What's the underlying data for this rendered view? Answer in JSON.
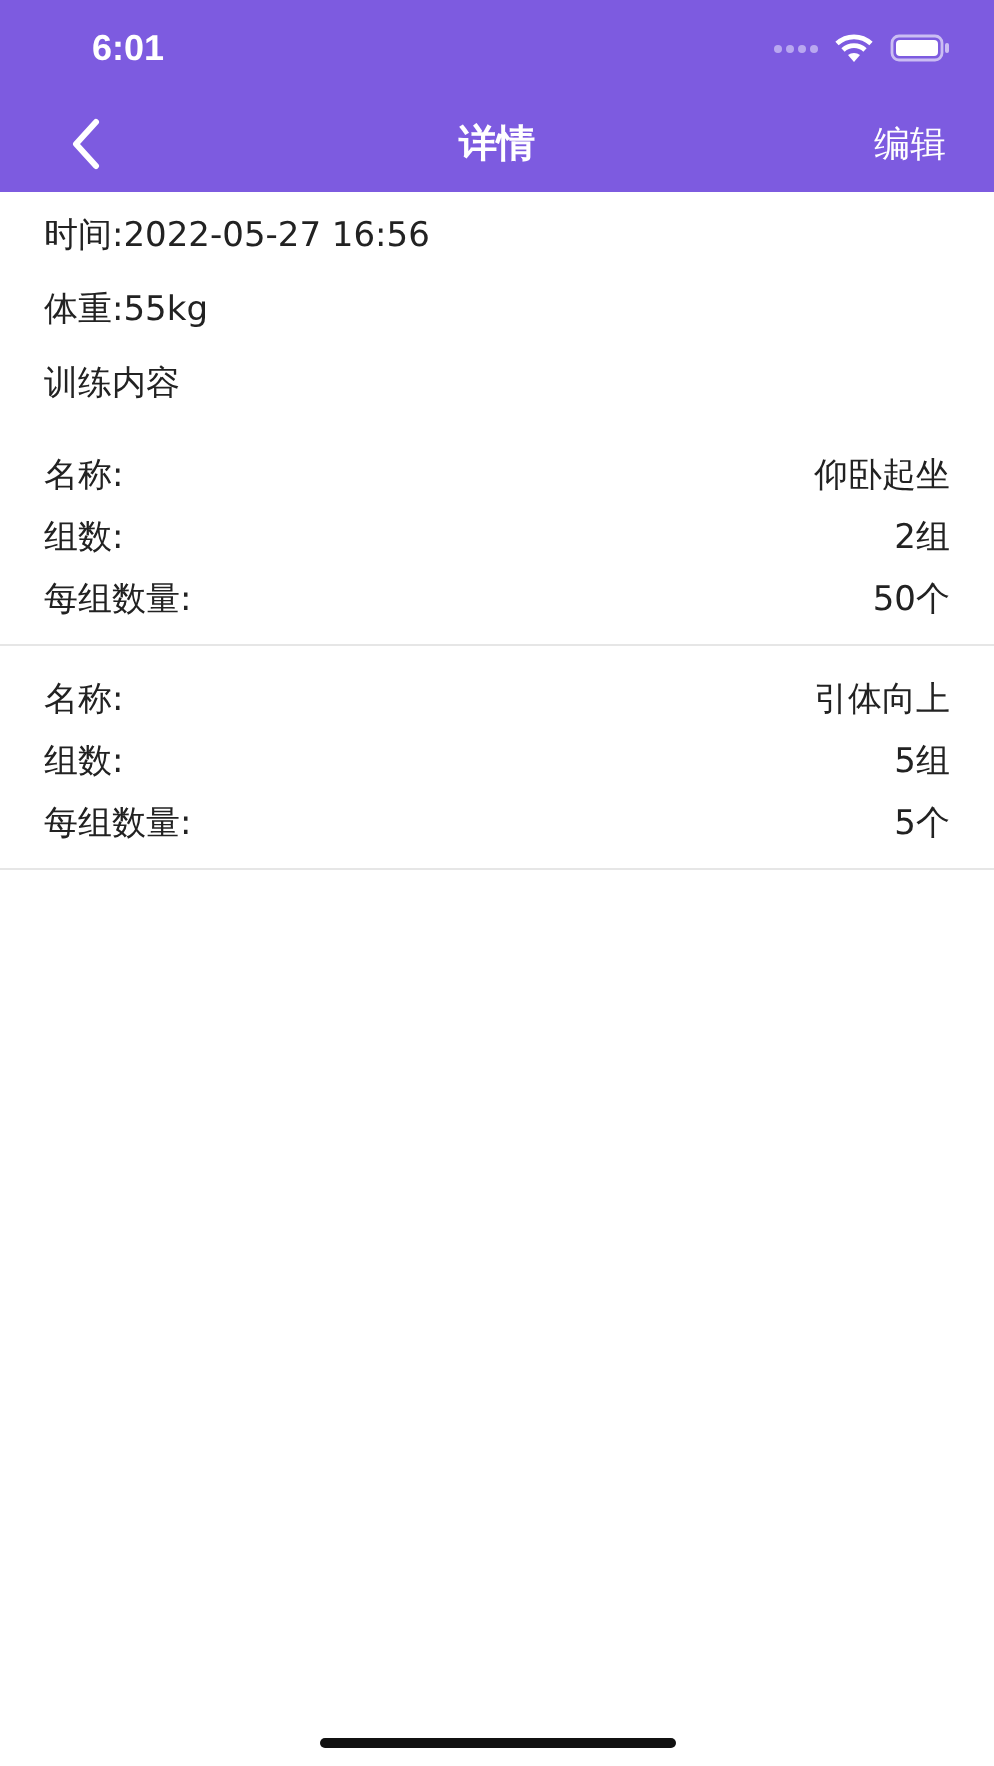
{
  "status_bar": {
    "time": "6:01"
  },
  "nav": {
    "title": "详情",
    "action": "编辑"
  },
  "info": [
    "时间:2022-05-27 16:56",
    "体重:55kg"
  ],
  "section_title": "训练内容",
  "exercises": [
    {
      "rows": [
        {
          "label": "名称:",
          "value": "仰卧起坐"
        },
        {
          "label": "组数:",
          "value": "2组"
        },
        {
          "label": "每组数量:",
          "value": "50个"
        }
      ]
    },
    {
      "rows": [
        {
          "label": "名称:",
          "value": "引体向上"
        },
        {
          "label": "组数:",
          "value": "5组"
        },
        {
          "label": "每组数量:",
          "value": "5个"
        }
      ]
    }
  ]
}
